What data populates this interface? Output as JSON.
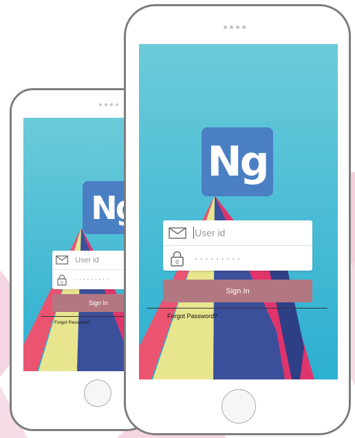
{
  "app": {
    "logo_text": "Ng",
    "username_placeholder": "User id",
    "password_mask": "·········",
    "sign_in_label": "Sign In",
    "forgot_password_label": "Forgot Password?",
    "icons": {
      "username": "envelope-icon",
      "password": "padlock-icon"
    }
  },
  "colors": {
    "screen_top": "#6ccbd9",
    "screen_bottom": "#2cafd1",
    "logo_bg": "#4a7fc4",
    "sign_in_bg": "#b37782",
    "ray_pink": "#ea5470",
    "ray_yellow": "#e8e58f",
    "ray_navy": "#3c4f9a",
    "ray_magenta": "#e0346c"
  }
}
